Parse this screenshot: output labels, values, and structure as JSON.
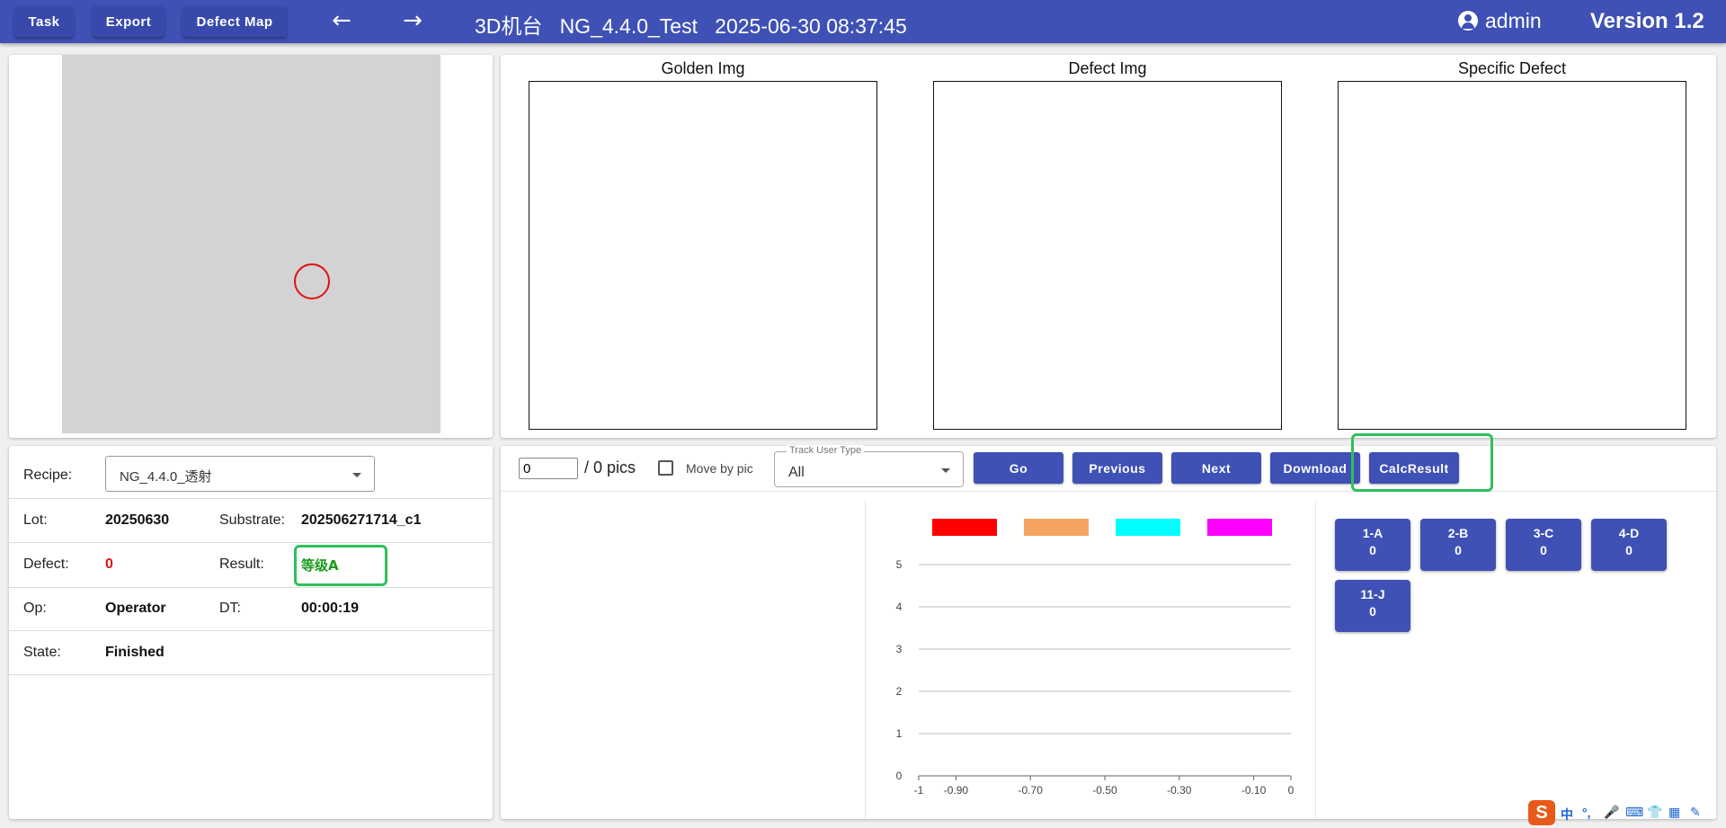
{
  "topbar": {
    "task_label": "Task",
    "export_label": "Export",
    "defect_map_label": "Defect Map",
    "back_icon": "←",
    "forward_icon": "→",
    "title": "3D机台   NG_4.4.0_Test   2025-06-30 08:37:45",
    "user": "admin",
    "version": "Version 1.2",
    "bar_color": "#3f51b5"
  },
  "images": {
    "golden_title": "Golden Img",
    "defect_title": "Defect Img",
    "specific_title": "Specific Defect"
  },
  "info": {
    "recipe_label": "Recipe:",
    "recipe_value": "NG_4.4.0_透射",
    "lot_label": "Lot:",
    "lot_value": "20250630",
    "substrate_label": "Substrate:",
    "substrate_value": "202506271714_c1",
    "defect_label": "Defect:",
    "defect_value": "0",
    "result_label": "Result:",
    "result_value": "等级A",
    "op_label": "Op:",
    "op_value": "Operator",
    "dt_label": "DT:",
    "dt_value": "00:00:19",
    "state_label": "State:",
    "state_value": "Finished"
  },
  "controls": {
    "pic_index": "0",
    "pic_total": "/ 0 pics",
    "move_by_pic_label": "Move by pic",
    "track_user_type_label": "Track User Type",
    "track_user_type_value": "All",
    "go_label": "Go",
    "previous_label": "Previous",
    "next_label": "Next",
    "download_label": "Download",
    "calc_result_label": "CalcResult"
  },
  "chart_data": {
    "type": "bar",
    "legend": [
      {
        "color": "#ff0000"
      },
      {
        "color": "#f4a460"
      },
      {
        "color": "#00ffff"
      },
      {
        "color": "#ff00ff"
      }
    ],
    "x_ticks": [
      "-1",
      "-0.90",
      "-0.70",
      "-0.50",
      "-0.30",
      "-0.10",
      "0"
    ],
    "y_ticks": [
      "0",
      "1",
      "2",
      "3",
      "4",
      "5"
    ],
    "xlim": [
      -1,
      0
    ],
    "ylim": [
      0,
      5
    ],
    "grid": true,
    "series": []
  },
  "categories": [
    {
      "name": "1-A",
      "count": "0"
    },
    {
      "name": "2-B",
      "count": "0"
    },
    {
      "name": "3-C",
      "count": "0"
    },
    {
      "name": "4-D",
      "count": "0"
    },
    {
      "name": "11-J",
      "count": "0"
    }
  ],
  "tray": {
    "s": "S",
    "zh": "中",
    "punct": "°,",
    "mic": "🎤",
    "kb": "⌨",
    "shirt": "👕",
    "grid": "▦",
    "more": "✎"
  }
}
